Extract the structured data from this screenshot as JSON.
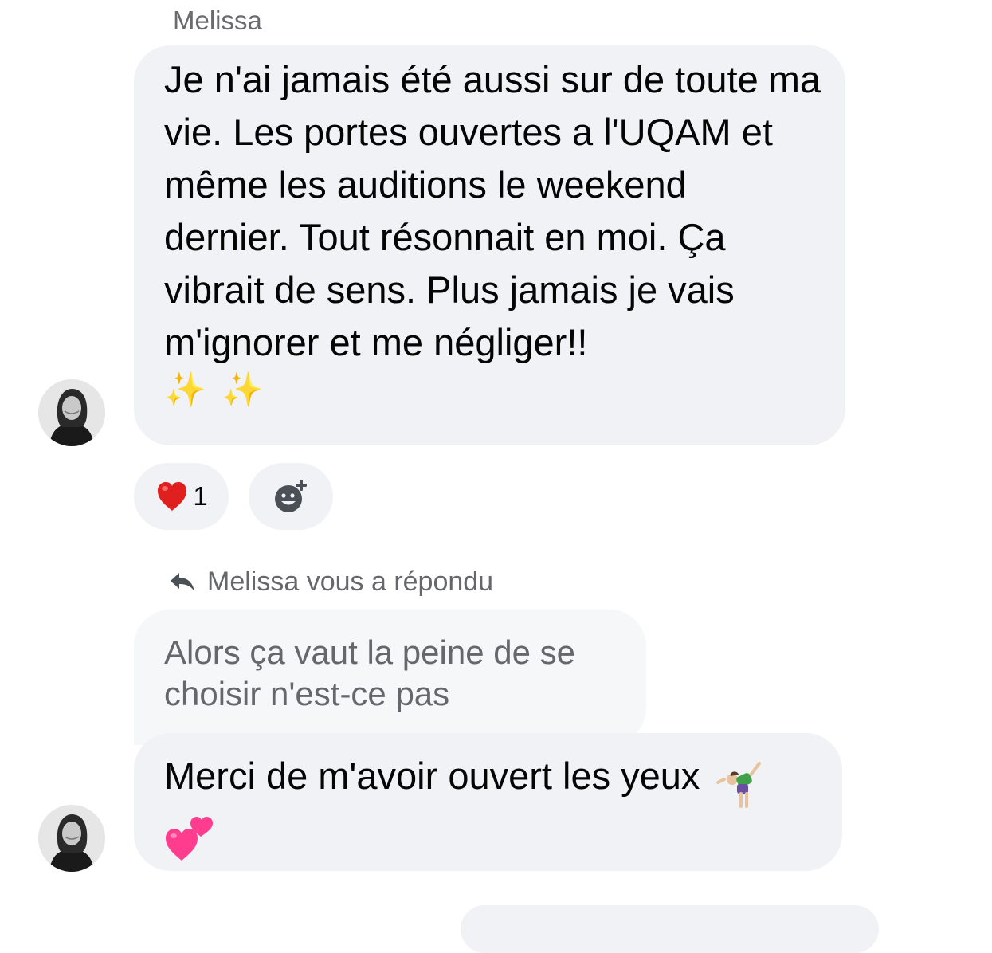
{
  "conversation": {
    "sender_name": "Melissa",
    "messages": [
      {
        "text": "Je n'ai jamais été aussi sur de toute ma vie. Les portes ouvertes a l'UQAM et même les auditions le weekend dernier. Tout résonnait en moi. Ça vibrait de sens. Plus jamais je vais m'ignorer et me négliger!!",
        "emoji_suffix": "✨ ✨",
        "reactions": [
          {
            "emoji": "heart-icon",
            "count": "1"
          }
        ]
      }
    ],
    "reply": {
      "label": "Melissa vous a répondu",
      "quoted_text": "Alors ça vaut la peine de se choisir n'est-ce pas",
      "text": "Merci de m'avoir ouvert les yeux",
      "emoji_icons": [
        "cartwheel-icon",
        "two-hearts-icon"
      ]
    }
  },
  "colors": {
    "bubble_bg": "#f0f2f5",
    "quoted_bg": "#f6f7f9",
    "text_primary": "#050505",
    "text_secondary": "#65676b",
    "heart": "#e0201e"
  }
}
